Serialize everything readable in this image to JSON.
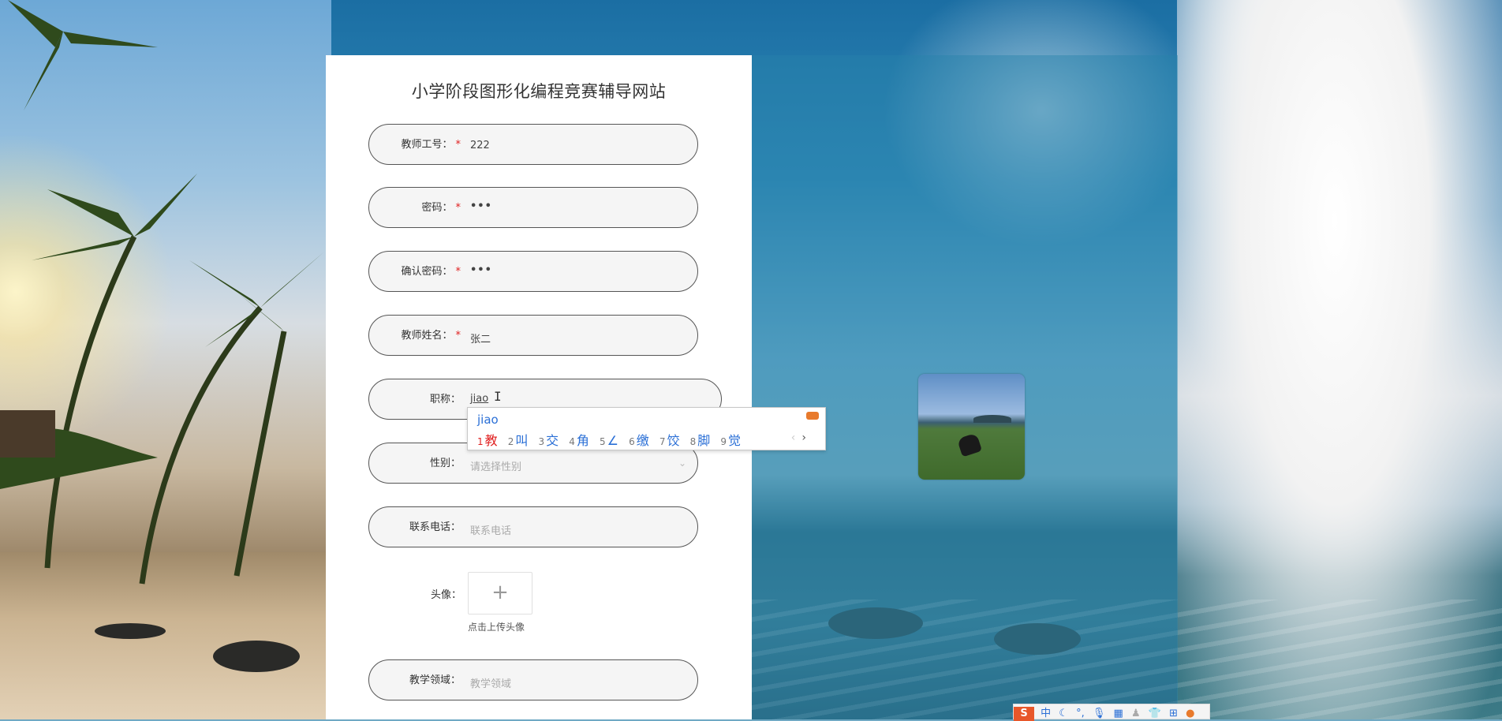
{
  "page": {
    "title": "小学阶段图形化编程竞赛辅导网站"
  },
  "form": {
    "teacher_id": {
      "label": "教师工号",
      "required": true,
      "value": "222"
    },
    "password": {
      "label": "密码",
      "required": true,
      "value": "•••"
    },
    "confirm_password": {
      "label": "确认密码",
      "required": true,
      "value": "•••"
    },
    "teacher_name": {
      "label": "教师姓名",
      "required": true,
      "value": "张二"
    },
    "title_field": {
      "label": "职称",
      "required": false,
      "value": "jiao"
    },
    "gender": {
      "label": "性别",
      "placeholder": "请选择性别"
    },
    "phone": {
      "label": "联系电话",
      "placeholder": "联系电话"
    },
    "avatar": {
      "label": "头像",
      "upload_icon": "+",
      "hint": "点击上传头像"
    },
    "teaching_area": {
      "label": "教学领域",
      "placeholder": "教学领域"
    },
    "label_suffix": "：",
    "required_mark": "*"
  },
  "ime_popup": {
    "pinyin": "jiao",
    "candidates": [
      {
        "n": "1",
        "text": "教"
      },
      {
        "n": "2",
        "text": "叫"
      },
      {
        "n": "3",
        "text": "交"
      },
      {
        "n": "4",
        "text": "角"
      },
      {
        "n": "5",
        "text": "∠"
      },
      {
        "n": "6",
        "text": "缴"
      },
      {
        "n": "7",
        "text": "饺"
      },
      {
        "n": "8",
        "text": "脚"
      },
      {
        "n": "9",
        "text": "觉"
      }
    ],
    "prev": "‹",
    "next": "›"
  },
  "ime_toolbar": {
    "logo": "S",
    "mode": "中",
    "icons": [
      "moon-icon",
      "punctuation-icon",
      "mic-icon",
      "keyboard-icon",
      "user-icon",
      "shirt-icon",
      "grid-icon",
      "mascot-icon"
    ]
  },
  "colors": {
    "required": "#e02020",
    "ime_blue": "#2a6fd6",
    "field_bg": "#f5f5f5"
  }
}
